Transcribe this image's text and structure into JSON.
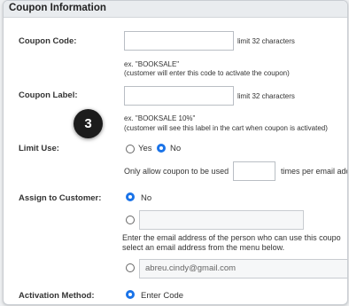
{
  "section": {
    "title": "Coupon Information"
  },
  "coupon_code": {
    "label": "Coupon Code:",
    "value": "",
    "limit": "limit 32 characters",
    "example": "ex. \"BOOKSALE\"",
    "note": "(customer will enter this code to activate the coupon)"
  },
  "coupon_label": {
    "label": "Coupon Label:",
    "value": "",
    "limit": "limit 32 characters",
    "example": "ex. \"BOOKSALE 10%\"",
    "note": "(customer will see this label in the cart when coupon is activated)"
  },
  "step_badge": "3",
  "limit_use": {
    "label": "Limit Use:",
    "options": [
      "Yes",
      "No"
    ],
    "selected": "No",
    "times_prefix": "Only allow coupon to be used",
    "times_value": "",
    "times_suffix": "times per email add"
  },
  "assign_customer": {
    "label": "Assign to Customer:",
    "option_no": "No",
    "email_value": "",
    "help_line1": "Enter the email address of the person who can use this coupo",
    "help_line2": "select an email address from the menu below.",
    "email_select": "abreu.cindy@gmail.com"
  },
  "activation": {
    "label": "Activation Method:",
    "option": "Enter Code"
  },
  "colors": {
    "accent": "#1a73e8",
    "header_bg": "#e9ecef"
  }
}
